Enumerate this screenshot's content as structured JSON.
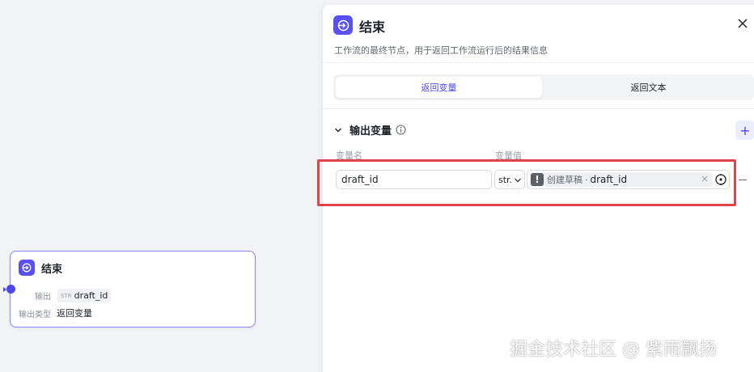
{
  "canvas_node": {
    "title": "结束",
    "output_label": "输出",
    "output_type_tag": "STR",
    "output_var": "draft_id",
    "output_type_label": "输出类型",
    "output_type_value": "返回变量"
  },
  "panel": {
    "title": "结束",
    "description": "工作流的最终节点，用于返回工作流运行后的结果信息",
    "tabs": [
      {
        "label": "返回变量",
        "active": true
      },
      {
        "label": "返回文本",
        "active": false
      }
    ],
    "section_title": "输出变量",
    "add_label": "+",
    "columns": {
      "name": "变量名",
      "value": "变量值"
    },
    "row": {
      "name_value": "draft_id",
      "type_value": "str.",
      "ref_source": "创建草稿",
      "ref_separator": "·",
      "ref_var": "draft_id",
      "warn_glyph": "!",
      "clear_glyph": "×"
    }
  },
  "watermark": "掘金技术社区 @ 紫雨飘扬",
  "colors": {
    "accent": "#4d47e6",
    "highlight": "#e0444a"
  }
}
